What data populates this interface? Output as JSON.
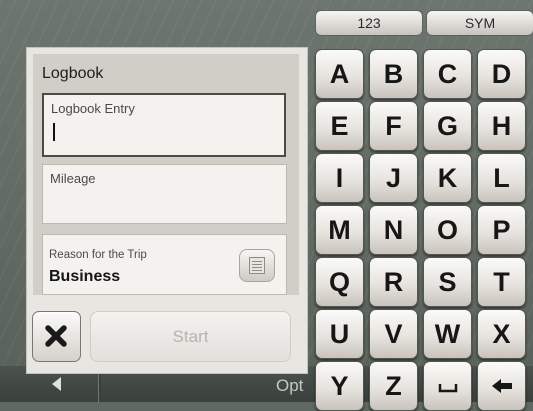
{
  "background": {
    "options_label": "Opt"
  },
  "dialog": {
    "title": "Logbook",
    "entry": {
      "label": "Logbook Entry",
      "value": ""
    },
    "mileage": {
      "label": "Mileage",
      "value": ""
    },
    "reason": {
      "label": "Reason for the Trip",
      "value": "Business"
    },
    "start_label": "Start",
    "start_enabled": false
  },
  "keyboard": {
    "mode_keys": [
      "123",
      "SYM"
    ],
    "rows": [
      [
        "A",
        "B",
        "C",
        "D"
      ],
      [
        "E",
        "F",
        "G",
        "H"
      ],
      [
        "I",
        "J",
        "K",
        "L"
      ],
      [
        "M",
        "N",
        "O",
        "P"
      ],
      [
        "Q",
        "R",
        "S",
        "T"
      ],
      [
        "U",
        "V",
        "W",
        "X"
      ],
      [
        "Y",
        "Z"
      ]
    ],
    "special_keys": [
      "space-icon",
      "backspace-icon"
    ]
  },
  "icons": {
    "close": "close-icon",
    "list": "list-icon",
    "back": "back-arrow-icon"
  },
  "colors": {
    "background": "#5f6962",
    "dialog": "#e8e6e1",
    "key_text": "#161616"
  }
}
